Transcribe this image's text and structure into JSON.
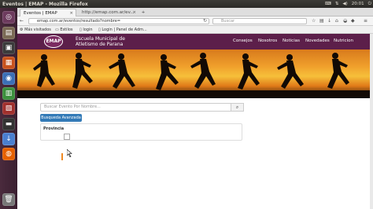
{
  "system": {
    "window_title": "Eventos | EMAP - Mozilla Firefox",
    "clock": "20:01"
  },
  "launcher": {
    "apps": [
      {
        "name": "dash-icon",
        "color": "#6d3b5e"
      },
      {
        "name": "files-icon",
        "color": "#7a6a55"
      },
      {
        "name": "terminal-icon",
        "color": "#3b3b3b"
      },
      {
        "name": "impress-icon",
        "color": "#c8521d"
      },
      {
        "name": "chromium-icon",
        "color": "#3b6fb5"
      },
      {
        "name": "calc-icon",
        "color": "#3c8f3c"
      },
      {
        "name": "software-center-icon",
        "color": "#a0302d"
      },
      {
        "name": "terminal-2-icon",
        "color": "#333333"
      },
      {
        "name": "downloads-icon",
        "color": "#4a7fcf"
      },
      {
        "name": "firefox-icon",
        "color": "#e66000"
      },
      {
        "name": "trash-icon",
        "color": "#777777"
      }
    ]
  },
  "browser": {
    "tabs": [
      {
        "label": "Eventos | EMAP",
        "active": true
      },
      {
        "label": "http://emap.com.ar/ev...",
        "active": false
      }
    ],
    "url": "emap.com.ar/eventos/resultado?nombre=",
    "search_placeholder": "Buscar",
    "bookmarks": [
      {
        "label": "Más visitados"
      },
      {
        "label": "Estilos"
      },
      {
        "label": "login"
      },
      {
        "label": "Login | Panel de Adm..."
      }
    ]
  },
  "site": {
    "logo": "EMAP",
    "brand_line1": "Escuela Municipal de",
    "brand_line2": "Atletismo de Parana",
    "menu": [
      {
        "label": "Consejos"
      },
      {
        "label": "Nosotros"
      },
      {
        "label": "Noticias"
      },
      {
        "label": "Novedades"
      },
      {
        "label": "Nutricion"
      }
    ],
    "brand_color": "#5c1f4a"
  },
  "search": {
    "placeholder": "Buscar Evento Por Nombre...",
    "button_icon": "search-icon",
    "advanced_label": "Busqueda Avanzada",
    "filter_label": "Provincia"
  }
}
